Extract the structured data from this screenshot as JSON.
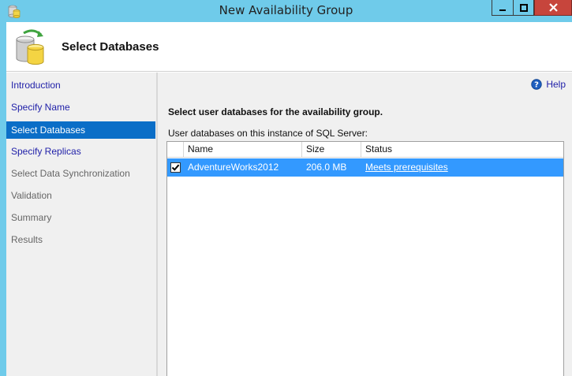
{
  "window": {
    "title": "New Availability Group",
    "controls": {
      "minimize_icon": "minimize-icon",
      "maximize_icon": "maximize-icon",
      "close_icon": "close-icon"
    },
    "close_color": "#c7453c",
    "chrome_color": "#6fcbea"
  },
  "header": {
    "title": "Select Databases",
    "icon": "database-icon"
  },
  "nav": {
    "items": [
      {
        "label": "Introduction",
        "state": "link"
      },
      {
        "label": "Specify Name",
        "state": "link"
      },
      {
        "label": "Select Databases",
        "state": "active"
      },
      {
        "label": "Specify Replicas",
        "state": "link"
      },
      {
        "label": "Select Data Synchronization",
        "state": "disabled"
      },
      {
        "label": "Validation",
        "state": "disabled"
      },
      {
        "label": "Summary",
        "state": "disabled"
      },
      {
        "label": "Results",
        "state": "disabled"
      }
    ],
    "active_color": "#0b6ec7"
  },
  "content": {
    "help_label": "Help",
    "help_icon": "help-icon",
    "instruction": "Select user databases for the availability group.",
    "sublabel": "User databases on this instance of SQL Server:",
    "table": {
      "columns": [
        "",
        "Name",
        "Size",
        "Status"
      ],
      "rows": [
        {
          "checked": true,
          "name": "AdventureWorks2012",
          "size": "206.0 MB",
          "status": "Meets prerequisites"
        }
      ],
      "selected_row_color": "#3399ff"
    }
  }
}
